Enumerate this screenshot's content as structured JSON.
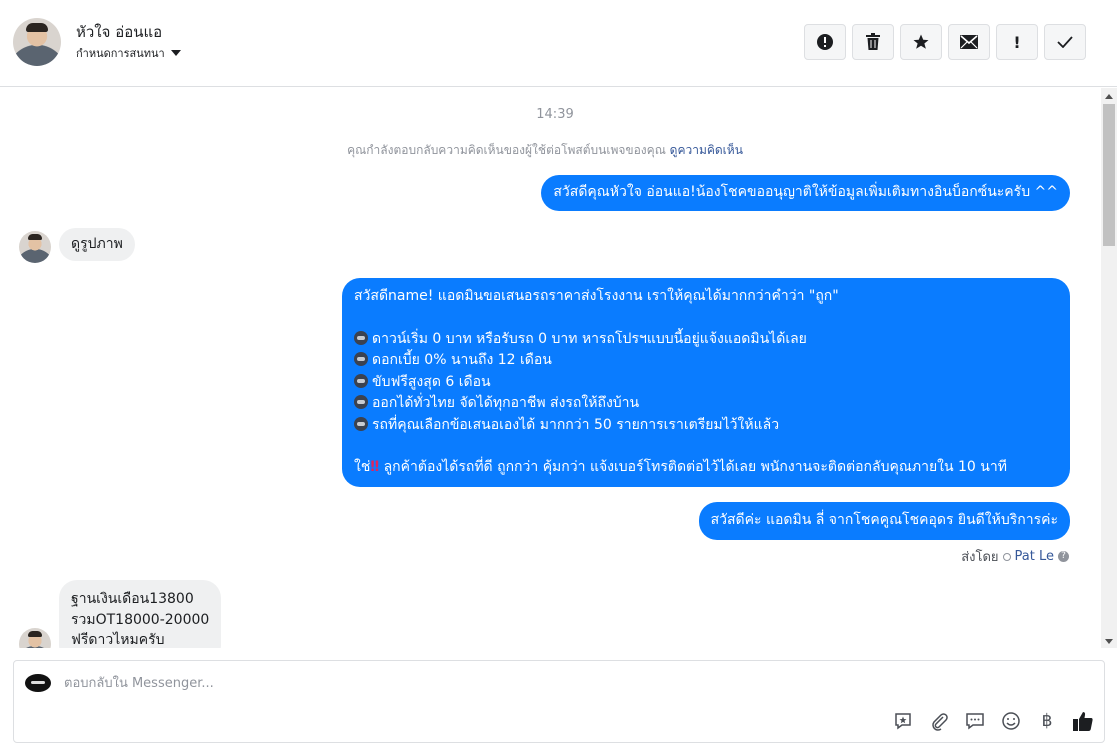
{
  "header": {
    "contact_name": "หัวใจ อ่อนแอ",
    "assign_label": "กำหนดการสนทนา",
    "toolbar": [
      {
        "name": "spam-alert-button",
        "icon": "alert-circle-icon",
        "glyph": "!"
      },
      {
        "name": "delete-button",
        "icon": "trash-icon",
        "glyph": "🗑"
      },
      {
        "name": "star-button",
        "icon": "star-icon",
        "glyph": "★"
      },
      {
        "name": "mark-unread-button",
        "icon": "envelope-icon",
        "glyph": "✉"
      },
      {
        "name": "important-button",
        "icon": "exclamation-icon",
        "glyph": "!"
      },
      {
        "name": "done-button",
        "icon": "check-icon",
        "glyph": "✓"
      }
    ]
  },
  "thread": {
    "time": "14:39",
    "notice_text": "คุณกำลังตอบกลับความคิดเห็นของผู้ใช้ต่อโพสต์บนเพจของคุณ",
    "notice_link": "ดูความคิดเห็น",
    "msg1": "สวัสดีคุณหัวใจ อ่อนแอ!น้องโชคขออนุญาติให้ข้อมูลเพิ่มเติมทางอินบ็อกซ์นะครับ ^^",
    "msg2": "ดูรูปภาพ",
    "msg3": {
      "line1": "สวัสดีname! แอดมินขอเสนอรถราคาส่งโรงงาน เราให้คุณได้มากกว่าคำว่า \"ถูก\"",
      "bullets": [
        "ดาวน์เริ่ม 0 บาท หรือรับรถ 0 บาท หารถโปรฯแบบนี้อยู่แจ้งแอดมินได้เลย",
        "ดอกเบี้ย 0% นานถึง 12 เดือน",
        "ขับฟรีสูงสุด 6 เดือน",
        "ออกได้ทั่วไทย จัดได้ทุกอาชีพ ส่งรถให้ถึงบ้าน",
        "รถที่คุณเลือกข้อเสนอเองได้ มากกว่า 50 รายการเราเตรียมไว้ให้แล้ว"
      ],
      "final_prefix": "ใช่",
      "final_mark": "‼",
      "final_rest": " ลูกค้าต้องได้รถที่ดี ถูกกว่า คุ้มกว่า แจ้งเบอร์โทรติดต่อไว้ได้เลย พนักงานจะติดต่อกลับคุณภายใน 10 นาที"
    },
    "msg4": "สวัสดีค่ะ แอดมิน ลี่ จากโชคคูณโชคอุดร ยินดีให้บริการค่ะ",
    "sent_by_label": "ส่งโดย",
    "sent_by_name": "Pat Le",
    "msg5_lines": [
      "ฐานเงินเดือน13800",
      "รวมOT18000-20000",
      "ฟรีดาวไหมครับ"
    ]
  },
  "composer": {
    "placeholder": "ตอบกลับใน Messenger...",
    "tools": [
      "saved-reply-icon",
      "attach-icon",
      "chat-icon",
      "emoji-icon",
      "payment-icon",
      "like-icon"
    ]
  },
  "colors": {
    "outgoing_bubble": "#0a7cff",
    "incoming_bubble": "#eff0f1",
    "link": "#365899"
  }
}
